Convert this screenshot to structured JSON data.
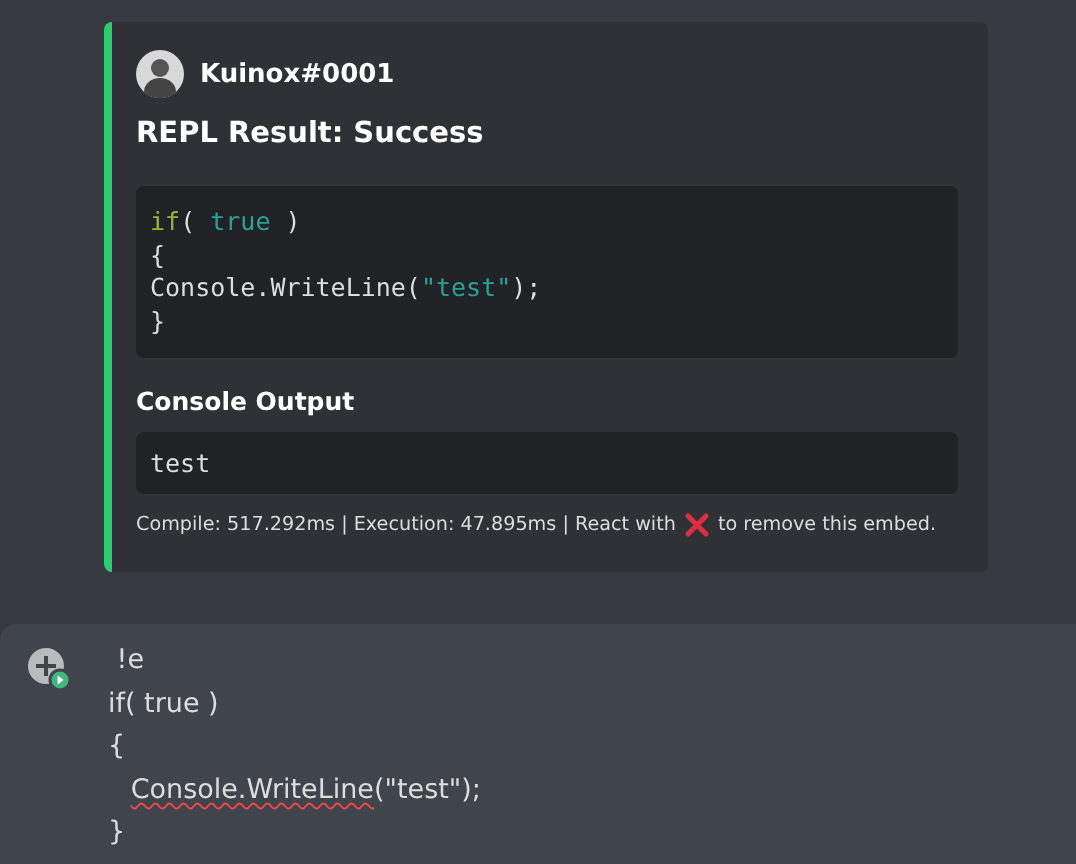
{
  "embed": {
    "author": "Kuinox#0001",
    "title": "REPL Result: Success",
    "code": [
      [
        {
          "kind": "keyword",
          "text": "if"
        },
        {
          "kind": "plain",
          "text": "( "
        },
        {
          "kind": "literal",
          "text": "true"
        },
        {
          "kind": "plain",
          "text": " )"
        }
      ],
      [
        {
          "kind": "plain",
          "text": "{"
        }
      ],
      [
        {
          "kind": "plain",
          "text": "Console.WriteLine("
        },
        {
          "kind": "string",
          "text": "\"test\""
        },
        {
          "kind": "plain",
          "text": ");"
        }
      ],
      [
        {
          "kind": "plain",
          "text": "}"
        }
      ]
    ],
    "output_heading": "Console Output",
    "output": "test",
    "footer_before": "Compile: 517.292ms | Execution: 47.895ms | React with",
    "footer_after": "to remove this embed."
  },
  "composer": {
    "lines": [
      {
        "segments": [
          {
            "text": " !e",
            "misspelled": false
          }
        ]
      },
      {
        "segments": [
          {
            "text": "if( true )",
            "misspelled": false
          }
        ]
      },
      {
        "segments": [
          {
            "text": "{",
            "misspelled": false
          }
        ]
      },
      {
        "segments": [
          {
            "text": "   Console.WriteLine",
            "misspelled": true
          },
          {
            "text": "(\"test\");",
            "misspelled": false
          }
        ]
      },
      {
        "segments": [
          {
            "text": "}",
            "misspelled": false
          }
        ]
      }
    ]
  }
}
